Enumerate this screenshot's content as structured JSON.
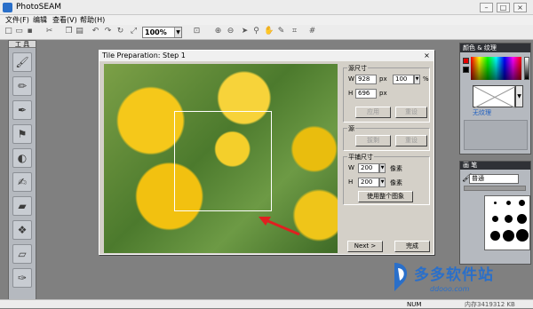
{
  "app": {
    "title": "PhotoSEAM"
  },
  "menu": [
    "文件(F)",
    "编辑",
    "查看(V)",
    "帮助(H)"
  ],
  "toolbar": {
    "zoom": "100%"
  },
  "tools_panel": {
    "title": "工 具"
  },
  "color_panel": {
    "title": "颜色 & 纹理",
    "pattern_label": "无纹理"
  },
  "brush_panel": {
    "title": "画 笔",
    "mode": "普通"
  },
  "dialog": {
    "title": "Tile Preparation: Step 1",
    "close": "×",
    "source": {
      "group_label": "源尺寸",
      "w_label": "W",
      "w_value": "928",
      "w_unit": "px",
      "pct_value": "100",
      "pct_unit": "%",
      "h_label": "H",
      "h_value": "696",
      "h_unit": "px",
      "apply": "应用",
      "reset": "重设"
    },
    "copy": {
      "group_label": "源",
      "copy_btn": "拔剩",
      "reset": "重设"
    },
    "tile": {
      "group_label": "平铺尺寸",
      "w_label": "W",
      "w_value": "200",
      "w_unit": "像素",
      "h_label": "H",
      "h_value": "200",
      "h_unit": "像素",
      "use_whole": "使用整个图象"
    },
    "next": "Next >",
    "finish": "完成"
  },
  "status": {
    "num": "NUM",
    "memory": "内存3419312 KB"
  },
  "watermark": {
    "name": "多多软件站",
    "url": "ddooo.com"
  }
}
